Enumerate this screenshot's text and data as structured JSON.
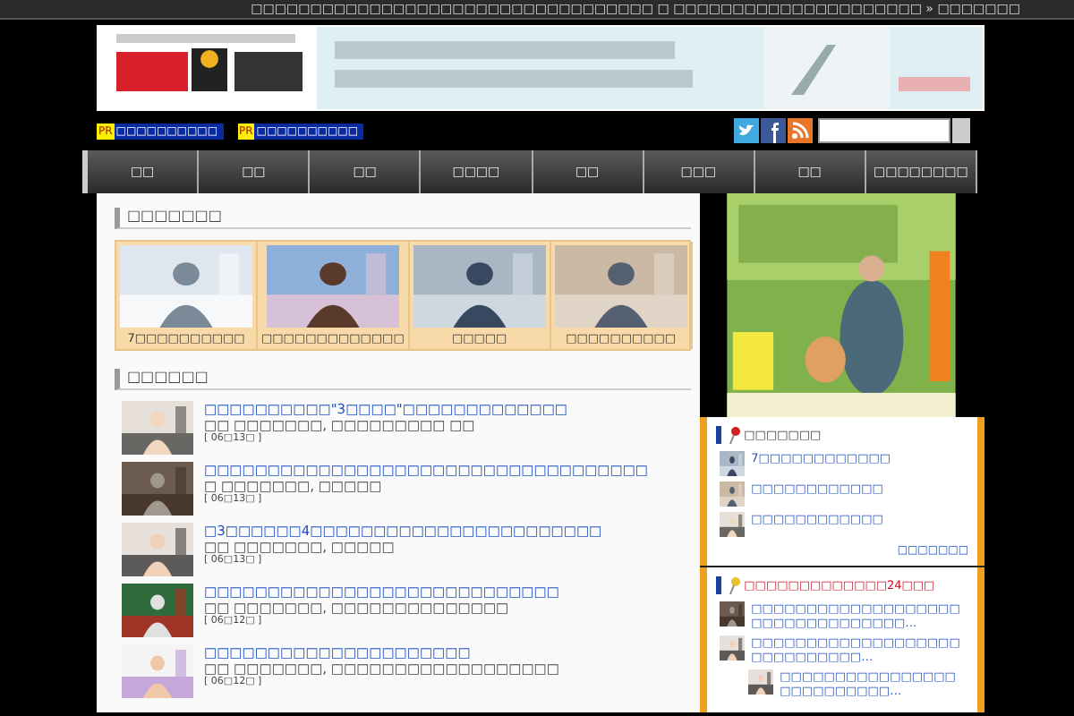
{
  "top_bar": {
    "text": "□□□□□□□□□□□□□□□□□□□□□□□□□□□□□□□□□□ □ □□□□□□□□□□□□□□□□□□□□□ » □□□□□□□"
  },
  "pr_links": [
    {
      "badge": "PR",
      "label": "□□□□□□□□□□"
    },
    {
      "badge": "PR",
      "label": "□□□□□□□□□□"
    }
  ],
  "search": {
    "kind": "field"
  },
  "nav": [
    {
      "label": "□□"
    },
    {
      "label": "□□"
    },
    {
      "label": "□□"
    },
    {
      "label": "□□□□"
    },
    {
      "label": "□□"
    },
    {
      "label": "□□□"
    },
    {
      "label": "□□"
    },
    {
      "label": "□□□□□□□□"
    }
  ],
  "features": {
    "title": "□□□□□□□",
    "cards": [
      {
        "caption": "7□□□□□□□□□□"
      },
      {
        "caption": "□□□□□□□□□□□□□"
      },
      {
        "caption": "□□□□□"
      },
      {
        "caption": "□□□□□□□□□□"
      }
    ]
  },
  "articles": {
    "title": "□□□□□□",
    "items": [
      {
        "title": "□□□□□□□□□□\"3□□□□\"□□□□□□□□□□□□□",
        "meta": "□□ □□□□□□□, □□□□□□□□□ □□",
        "date": "[ 06□13□ ]"
      },
      {
        "title": "□□□□□□□□□□□□□□□□□□□□□□□□□□□□□□□□□□□",
        "meta": "□ □□□□□□□, □□□□□",
        "date": "[ 06□13□ ]"
      },
      {
        "title": "□3□□□□□□4□□□□□□□□□□□□□□□□□□□□□□□",
        "meta": "□□ □□□□□□□, □□□□□",
        "date": "[ 06□13□ ]"
      },
      {
        "title": "□□□□□□□□□□□□□□□□□□□□□□□□□□□□",
        "meta": "□□ □□□□□□□, □□□□□□□□□□□□□□",
        "date": "[ 06□12□ ]"
      },
      {
        "title": "□□□□□□□□□□□□□□□□□□□□□",
        "meta": "□□ □□□□□□□, □□□□□□□□□□□□□□□□□□",
        "date": "[ 06□12□ ]"
      }
    ]
  },
  "sidebar": {
    "popular": {
      "title": "□□□□□□□",
      "items": [
        {
          "label": "7□□□□□□□□□□□□"
        },
        {
          "label": "□□□□□□□□□□□□"
        },
        {
          "label": "□□□□□□□□□□□□"
        }
      ],
      "more": "□□□□□□□"
    },
    "ranking": {
      "title": "□□□□□□□□□□□□□24□□□",
      "items": [
        {
          "label": "□□□□□□□□□□□□□□□□□□□□□□□□□□□□□□□□□…"
        },
        {
          "label": "□□□□□□□□□□□□□□□□□□□□□□□□□□□□□…",
          "children": [
            {
              "label": "□□□□□□□□□□□□□□□□ □□□□□□□□□□…"
            }
          ]
        }
      ]
    }
  }
}
